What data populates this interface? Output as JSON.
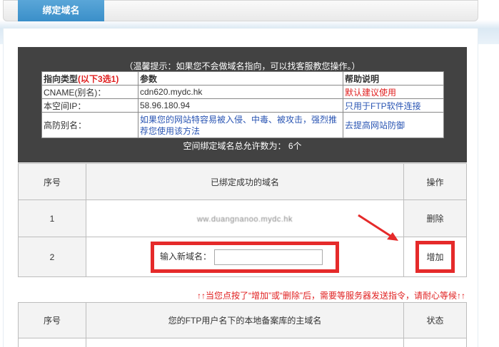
{
  "header": {
    "tab_label": "绑定域名"
  },
  "tip": "（温馨提示：如果您不会做域名指向，可以找客服教您操作。）",
  "info_table": {
    "headers": {
      "type": "指向类型",
      "type_hint": "(以下3选1)",
      "param": "参数",
      "help": "帮助说明"
    },
    "rows": [
      {
        "type": "CNAME(别名)：",
        "param": "cdn620.mydc.hk",
        "help": "默认建议使用"
      },
      {
        "type": "本空间IP：",
        "param": "58.96.180.94",
        "help": "只用于FTP软件连接"
      },
      {
        "type": "高防别名：",
        "param": "如果您的网站特容易被入侵、中毒、被攻击，强烈推荐您使用该方法",
        "help": "去提高网站防御"
      }
    ]
  },
  "limit_text": "空间绑定域名总允许数为： 6个",
  "domain_table": {
    "headers": {
      "index": "序号",
      "domain": "已绑定成功的域名",
      "action": "操作"
    },
    "rows": [
      {
        "index": "1",
        "domain": "ww.duangnanoo.mydc.hk",
        "action": "删除"
      },
      {
        "index": "2",
        "new_label": "输入新域名：",
        "new_value": "",
        "action": "增加"
      }
    ]
  },
  "notice": "↑↑当您点按了“增加”或“删除”后，需要等服务器发送指令，请耐心等候↑↑",
  "ftp_table": {
    "headers": {
      "index": "序号",
      "domain": "您的FTP用户名下的本地备案库的主域名",
      "status": "状态"
    }
  },
  "colors": {
    "tab": "#3a8fc9",
    "highlight": "#e52a2a",
    "panel": "#424242",
    "warning": "#e02020",
    "link": "#2a55b3"
  },
  "icons": {
    "arrow": "red-arrow-icon"
  }
}
